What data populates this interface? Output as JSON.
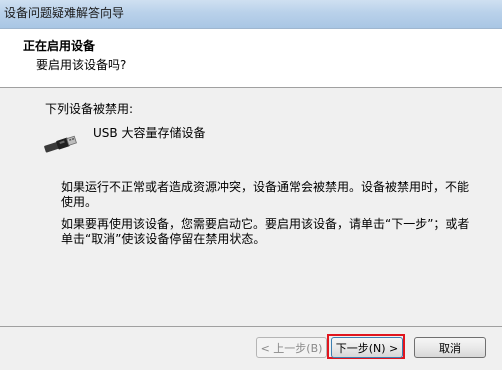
{
  "window": {
    "title": "设备问题疑难解答向导"
  },
  "header": {
    "title": "正在启用设备",
    "subtitle": "要启用该设备吗?"
  },
  "content": {
    "section_label": "下列设备被禁用:",
    "device_icon": "usb-plug-icon",
    "device_name": "USB 大容量存储设备",
    "paragraph1": "如果运行不正常或者造成资源冲突，设备通常会被禁用。设备被禁用时，不能使用。",
    "paragraph2": "如果要再使用该设备，您需要启动它。要启用该设备，请单击“下一步”；或者单击“取消”使该设备停留在禁用状态。"
  },
  "buttons": {
    "back_label": "< 上一步(B)",
    "next_label": "下一步(N) >",
    "cancel_label": "取消"
  },
  "colors": {
    "highlight": "#e0161f",
    "titlebar": "#b9d1ea"
  }
}
